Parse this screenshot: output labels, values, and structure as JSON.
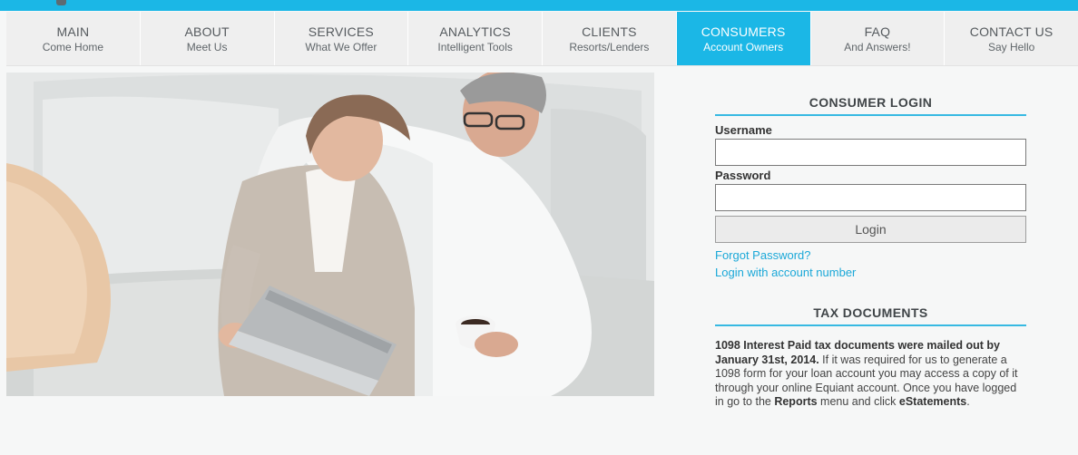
{
  "nav": {
    "items": [
      {
        "title": "MAIN",
        "subtitle": "Come Home"
      },
      {
        "title": "ABOUT",
        "subtitle": "Meet Us"
      },
      {
        "title": "SERVICES",
        "subtitle": "What We Offer"
      },
      {
        "title": "ANALYTICS",
        "subtitle": "Intelligent Tools"
      },
      {
        "title": "CLIENTS",
        "subtitle": "Resorts/Lenders"
      },
      {
        "title": "CONSUMERS",
        "subtitle": "Account Owners"
      },
      {
        "title": "FAQ",
        "subtitle": "And Answers!"
      },
      {
        "title": "CONTACT US",
        "subtitle": "Say Hello"
      }
    ],
    "active_index": 5
  },
  "login": {
    "title": "CONSUMER LOGIN",
    "username_label": "Username",
    "username_value": "",
    "password_label": "Password",
    "password_value": "",
    "button_label": "Login",
    "forgot_link": "Forgot Password?",
    "account_number_link": "Login with account number"
  },
  "tax": {
    "title": "TAX DOCUMENTS",
    "bold_intro": "1098 Interest Paid tax documents were mailed out by January 31st, 2014.",
    "body_1": " If it was required for us to generate a 1098 form for your loan account you may access a copy of it through your online Equiant account. Once you have logged in go to the ",
    "reports": "Reports",
    "body_2": " menu and click ",
    "estatements_e": "e",
    "estatements_rest": "Statements",
    "end": "."
  },
  "colors": {
    "accent": "#1bb7e6",
    "link": "#1ba8d8",
    "nav_bg": "#efefef"
  }
}
